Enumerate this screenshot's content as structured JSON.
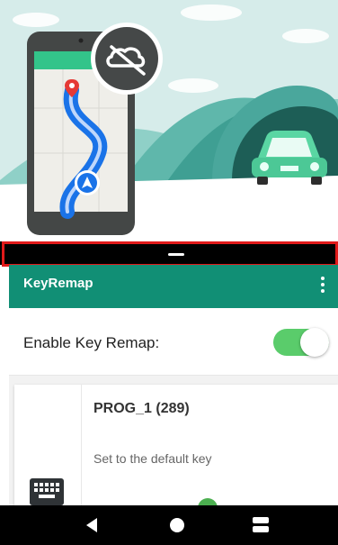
{
  "illustration": {
    "cloud_status_icon": "cloud-off-icon",
    "map_pin_icon": "map-pin-icon",
    "navigation_arrow_icon": "navigation-arrow-icon",
    "car_icon": "car-icon"
  },
  "divider": {
    "handle_icon": "drag-handle-icon"
  },
  "app_bar": {
    "title": "KeyRemap",
    "menu_icon": "more-vert-icon"
  },
  "settings": {
    "enable_label": "Enable Key Remap:",
    "enabled": true
  },
  "key_list": [
    {
      "name": "PROG_1 (289)",
      "description": "Set to the default key",
      "icon": "keyboard-icon"
    }
  ],
  "nav_bar": {
    "back_icon": "back-triangle-icon",
    "home_icon": "home-circle-icon",
    "recents_icon": "recents-square-icon"
  },
  "colors": {
    "accent": "#118f75",
    "toggle_on": "#5acc6b",
    "highlight_outline": "#e11a1a"
  }
}
